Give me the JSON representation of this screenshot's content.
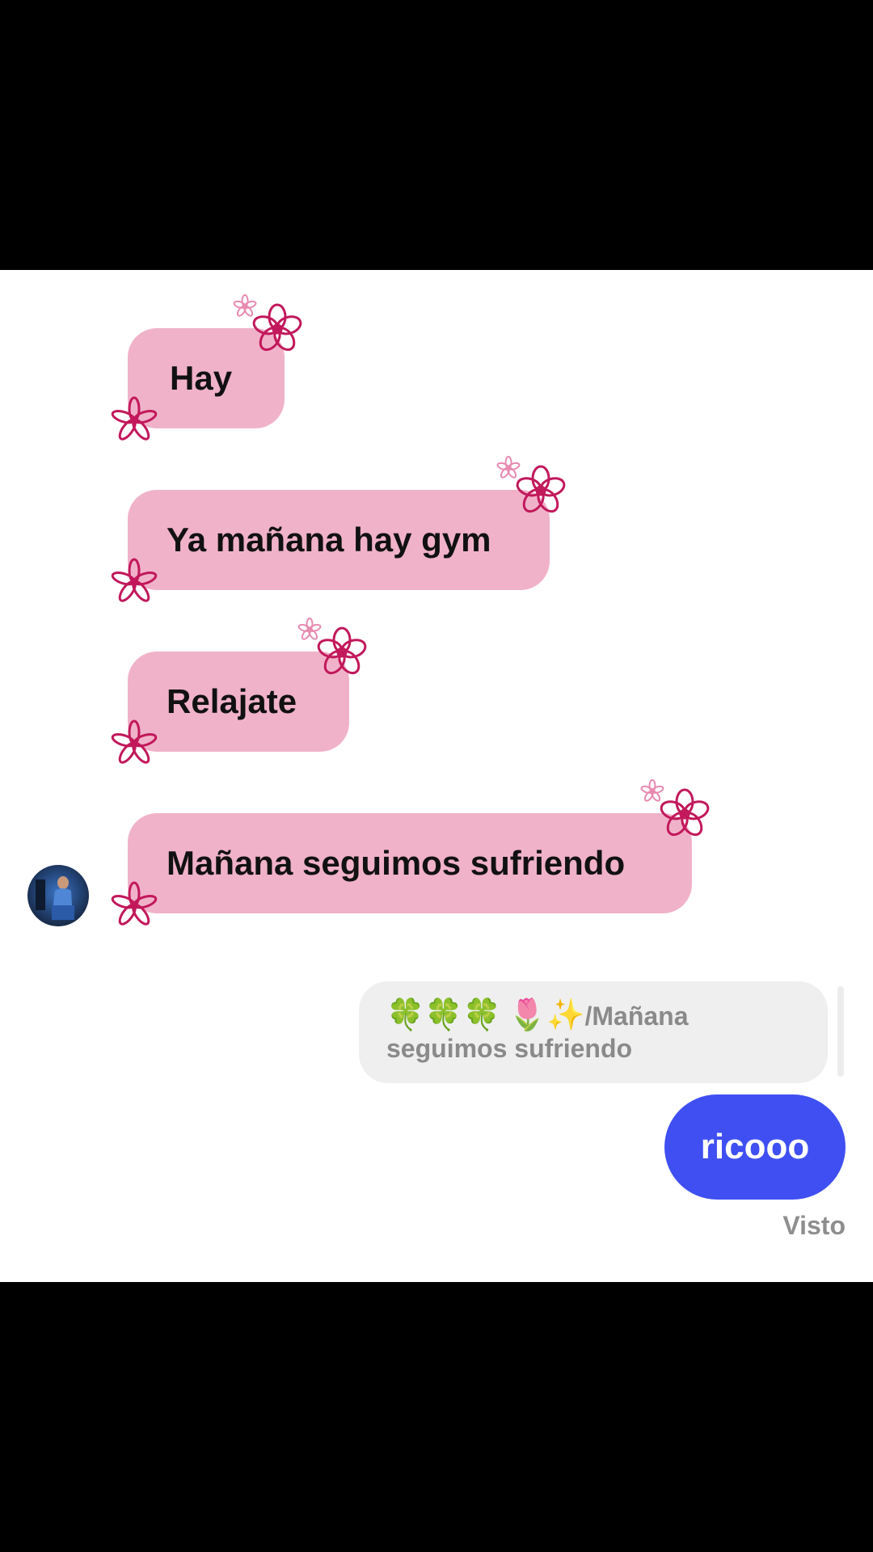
{
  "messages_received": [
    {
      "text": "Hay"
    },
    {
      "text": "Ya mañana hay gym"
    },
    {
      "text": "Relajate"
    },
    {
      "text": "Mañana seguimos sufriendo"
    }
  ],
  "reply_preview": {
    "decor": "🍀🍀🍀",
    "prefix": "🌷✨",
    "text": "/Mañana seguimos sufriendo"
  },
  "sent_message": {
    "text": "ricooo"
  },
  "status": {
    "seen": "Visto"
  },
  "colors": {
    "received_bubble": "#f0b2c9",
    "sent_bubble": "#3f4ff2",
    "flower": "#c2185b",
    "reply_bubble": "#efefef"
  },
  "icons": {
    "decoration": "flower-icon",
    "avatar": "user-avatar"
  }
}
